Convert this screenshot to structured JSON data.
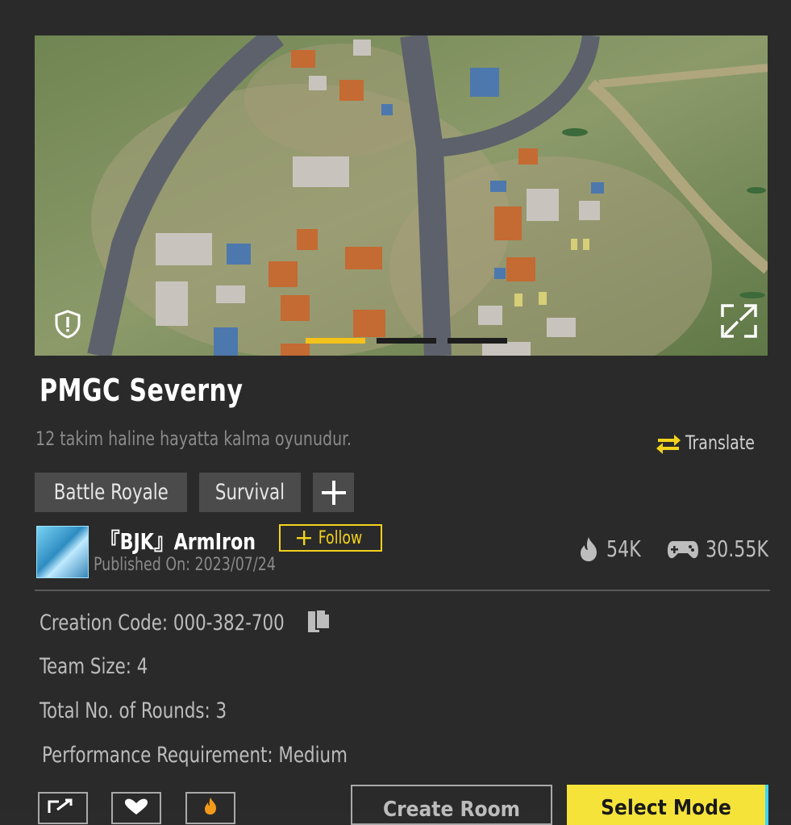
{
  "map": {
    "title": "PMGC Severny",
    "description": "12 takim haline hayatta kalma oyunudur.",
    "translate_label": "Translate",
    "tags": [
      "Battle Royale",
      "Survival"
    ],
    "add_tag_label": "+",
    "carousel": {
      "count": 3,
      "active_index": 0
    }
  },
  "author": {
    "name": "『BJK』ArmIron",
    "follow_label": "Follow",
    "published": "Published On: 2023/07/24"
  },
  "stats": {
    "popularity": "54K",
    "plays": "30.55K"
  },
  "details": {
    "creation_code": "Creation Code: 000-382-700",
    "team_size": "Team Size: 4",
    "rounds": "Total No. of Rounds: 3",
    "performance": "Performance Requirement: Medium"
  },
  "actions": {
    "create_room_label": "Create Room",
    "select_mode_label": "Select Mode"
  },
  "colors": {
    "accent": "#f3d21b",
    "background": "#2a2a2a",
    "tag_bg": "#4b4b4b"
  },
  "icons": [
    "shield-alert-icon",
    "expand-icon",
    "swap-arrows-icon",
    "flame-icon",
    "gamepad-icon",
    "copy-icon",
    "share-icon",
    "heart-icon",
    "flame-badge-icon"
  ]
}
